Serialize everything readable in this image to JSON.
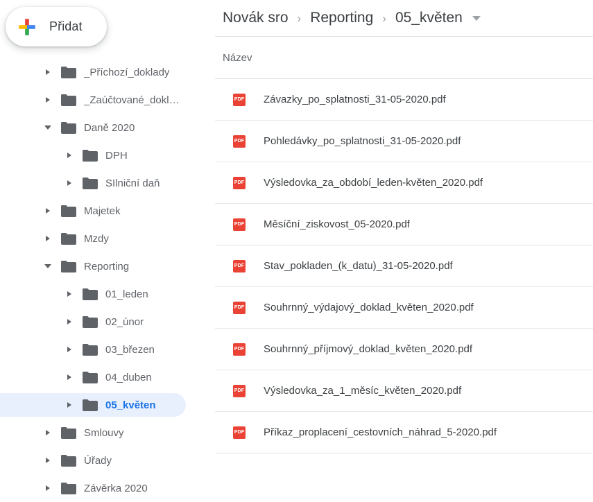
{
  "sidebar": {
    "add_button": {
      "label": "Přidat",
      "icon": "google-plus-icon"
    },
    "tree_items": [
      {
        "label": "_Příchozí_doklady",
        "level": 0,
        "expanded": false,
        "selected": false
      },
      {
        "label": "_Zaúčtované_dokl…",
        "level": 0,
        "expanded": false,
        "selected": false
      },
      {
        "label": "Daně 2020",
        "level": 0,
        "expanded": true,
        "selected": false
      },
      {
        "label": "DPH",
        "level": 1,
        "expanded": false,
        "selected": false
      },
      {
        "label": "SIlniční daň",
        "level": 1,
        "expanded": false,
        "selected": false
      },
      {
        "label": "Majetek",
        "level": 0,
        "expanded": false,
        "selected": false
      },
      {
        "label": "Mzdy",
        "level": 0,
        "expanded": false,
        "selected": false
      },
      {
        "label": "Reporting",
        "level": 0,
        "expanded": true,
        "selected": false
      },
      {
        "label": "01_leden",
        "level": 1,
        "expanded": false,
        "selected": false
      },
      {
        "label": "02_únor",
        "level": 1,
        "expanded": false,
        "selected": false
      },
      {
        "label": "03_březen",
        "level": 1,
        "expanded": false,
        "selected": false
      },
      {
        "label": "04_duben",
        "level": 1,
        "expanded": false,
        "selected": false
      },
      {
        "label": "05_květen",
        "level": 1,
        "expanded": false,
        "selected": true
      },
      {
        "label": "Smlouvy",
        "level": 0,
        "expanded": false,
        "selected": false
      },
      {
        "label": "Úřady",
        "level": 0,
        "expanded": false,
        "selected": false
      },
      {
        "label": "Závěrka 2020",
        "level": 0,
        "expanded": false,
        "selected": false
      }
    ]
  },
  "main": {
    "breadcrumb": {
      "separator": "›",
      "crumbs": [
        "Novák sro",
        "Reporting",
        "05_květen"
      ],
      "caret_icon": "chevron-down-icon"
    },
    "column_header": {
      "name": "Název"
    },
    "files": [
      {
        "name": "Závazky_po_splatnosti_31-05-2020.pdf",
        "icon": "pdf-icon"
      },
      {
        "name": "Pohledávky_po_splatnosti_31-05-2020.pdf",
        "icon": "pdf-icon"
      },
      {
        "name": "Výsledovka_za_období_leden-květen_2020.pdf",
        "icon": "pdf-icon"
      },
      {
        "name": "Měsíční_ziskovost_05-2020.pdf",
        "icon": "pdf-icon"
      },
      {
        "name": "Stav_pokladen_(k_datu)_31-05-2020.pdf",
        "icon": "pdf-icon"
      },
      {
        "name": "Souhrnný_výdajový_doklad_květen_2020.pdf",
        "icon": "pdf-icon"
      },
      {
        "name": "Souhrnný_příjmový_doklad_květen_2020.pdf",
        "icon": "pdf-icon"
      },
      {
        "name": "Výsledovka_za_1_měsíc_květen_2020.pdf",
        "icon": "pdf-icon"
      },
      {
        "name": "Příkaz_proplacení_cestovních_náhrad_5-2020.pdf",
        "icon": "pdf-icon"
      }
    ],
    "pdf_badge_text": "PDF"
  },
  "colors": {
    "accent_blue": "#1a73e8",
    "selection_bg": "#e8f0fe",
    "icon_gray": "#5f6368",
    "pdf_red": "#ea4335",
    "plus_blue": "#4285f4",
    "plus_red": "#ea4335",
    "plus_yellow": "#fbbc04",
    "plus_green": "#34a853"
  }
}
